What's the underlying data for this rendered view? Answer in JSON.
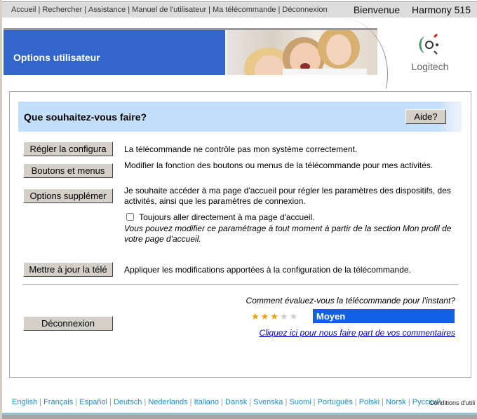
{
  "topnav": {
    "links": [
      "Accueil",
      "Rechercher",
      "Assistance",
      "Manuel de l'utilisateur",
      "Ma télécommande",
      "Déconnexion"
    ],
    "welcome": "Bienvenue",
    "model": "Harmony 515"
  },
  "banner": {
    "title": "Options utilisateur",
    "logo": "Logitech"
  },
  "question": {
    "title": "Que souhaitez-vous faire?",
    "help": "Aide?"
  },
  "options": [
    {
      "button": "Régler la configura",
      "desc": "La télécommande ne contrôle pas mon système correctement."
    },
    {
      "button": "Boutons et menus",
      "desc": "Modifier la fonction des boutons ou menus de la télécommande pour mes activités."
    },
    {
      "button": "Options supplémer",
      "desc": "Je souhaite accéder à ma page d'accueil pour régler les paramètres des dispositifs, des activités, ainsi que les paramètres de connexion."
    },
    {
      "button": "Mettre à jour la télé",
      "desc": "Appliquer les modifications apportées à la configuration de la télécommande."
    }
  ],
  "home_checkbox": {
    "label": "Toujours aller directement à ma page d'accueil.",
    "checked": false,
    "note": "Vous pouvez modifier ce paramétrage à tout moment à partir de la section Mon profil de votre page d'accueil."
  },
  "logout_button": "Déconnexion",
  "rating": {
    "question": "Comment évaluez-vous la télécommande pour l'instant?",
    "stars": 3,
    "max": 5,
    "label": "Moyen",
    "star_color": "#f5a000",
    "feedback_link": "Cliquez ici pour nous faire part de vos commentaires"
  },
  "footer": {
    "languages": [
      "English",
      "Français",
      "Español",
      "Deutsch",
      "Nederlands",
      "Italiano",
      "Dansk",
      "Svenska",
      "Suomi",
      "Português",
      "Polski",
      "Norsk",
      "Русский"
    ],
    "terms": "Conditions d'utili"
  }
}
